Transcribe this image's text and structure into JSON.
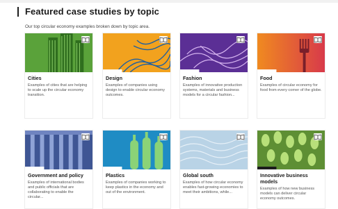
{
  "header": {
    "title": "Featured case studies by topic",
    "subtitle": "Our top circular economy examples broken down by topic area."
  },
  "cards": [
    {
      "title": "Cities",
      "desc": "Examples of cities that are helping to scale up the circular economy transition.",
      "icon": "bookmark-icon",
      "color": "#5fa23a"
    },
    {
      "title": "Design",
      "desc": "Examples of companies using design to enable circular economy outcomes.",
      "icon": "bookmark-icon",
      "color": "#f0a020"
    },
    {
      "title": "Fashion",
      "desc": "Examples of innovative production systems, materials and business models for a circular fashion...",
      "icon": "bookmark-icon",
      "color": "#6b3aa8"
    },
    {
      "title": "Food",
      "desc": "Examples of circular economy for food from every corner of the globe.",
      "icon": "bookmark-icon",
      "color": "#e85a2a"
    },
    {
      "title": "Government and policy",
      "desc": "Examples of international bodies and public officials that are collaborating to enable the circular...",
      "icon": "bookmark-icon",
      "color": "#4a5e9a"
    },
    {
      "title": "Plastics",
      "desc": "Examples of companies working to keep plastics in the economy and out of the environment.",
      "icon": "bookmark-icon",
      "color": "#1f8fc7"
    },
    {
      "title": "Global south",
      "desc": "Examples of how circular economy enables fast-growing economies to meet their ambitions, while...",
      "icon": "bookmark-icon",
      "color": "#b8d2e6"
    },
    {
      "title": "Innovative business models",
      "desc": "Examples of how new business models can deliver circular economy outcomes.",
      "icon": "bookmark-icon",
      "color": "#6a9a3a"
    }
  ]
}
